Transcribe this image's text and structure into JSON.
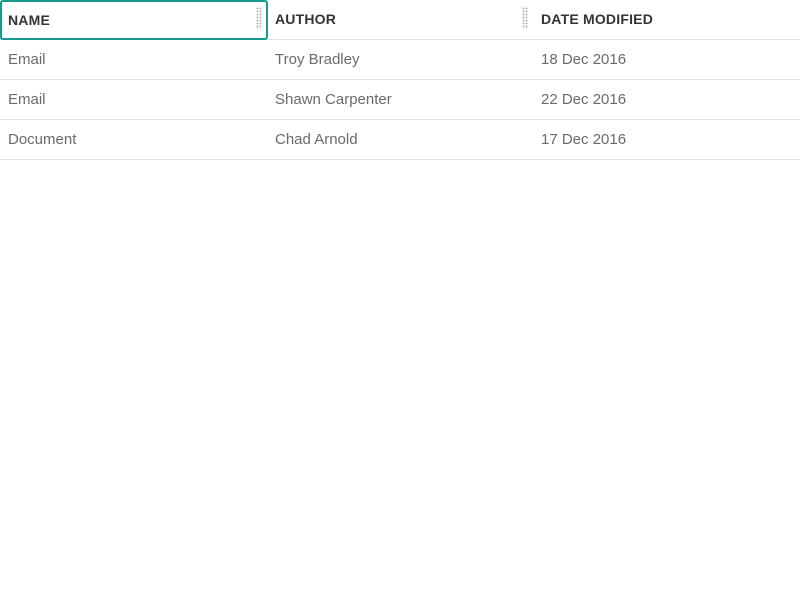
{
  "table": {
    "columns": [
      "NAME",
      "AUTHOR",
      "DATE MODIFIED"
    ],
    "rows": [
      [
        "Email",
        "Troy Bradley",
        "18 Dec 2016"
      ],
      [
        "Email",
        "Shawn Carpenter",
        "22 Dec 2016"
      ],
      [
        "Document",
        "Chad Arnold",
        "17 Dec 2016"
      ]
    ]
  },
  "colors": {
    "focus_border": "#159a8f",
    "header_text": "#333333",
    "body_text": "#6a6a6a",
    "row_divider": "#e3e3e3"
  },
  "icons": {
    "column_resize": "column-resize-handle-icon"
  }
}
